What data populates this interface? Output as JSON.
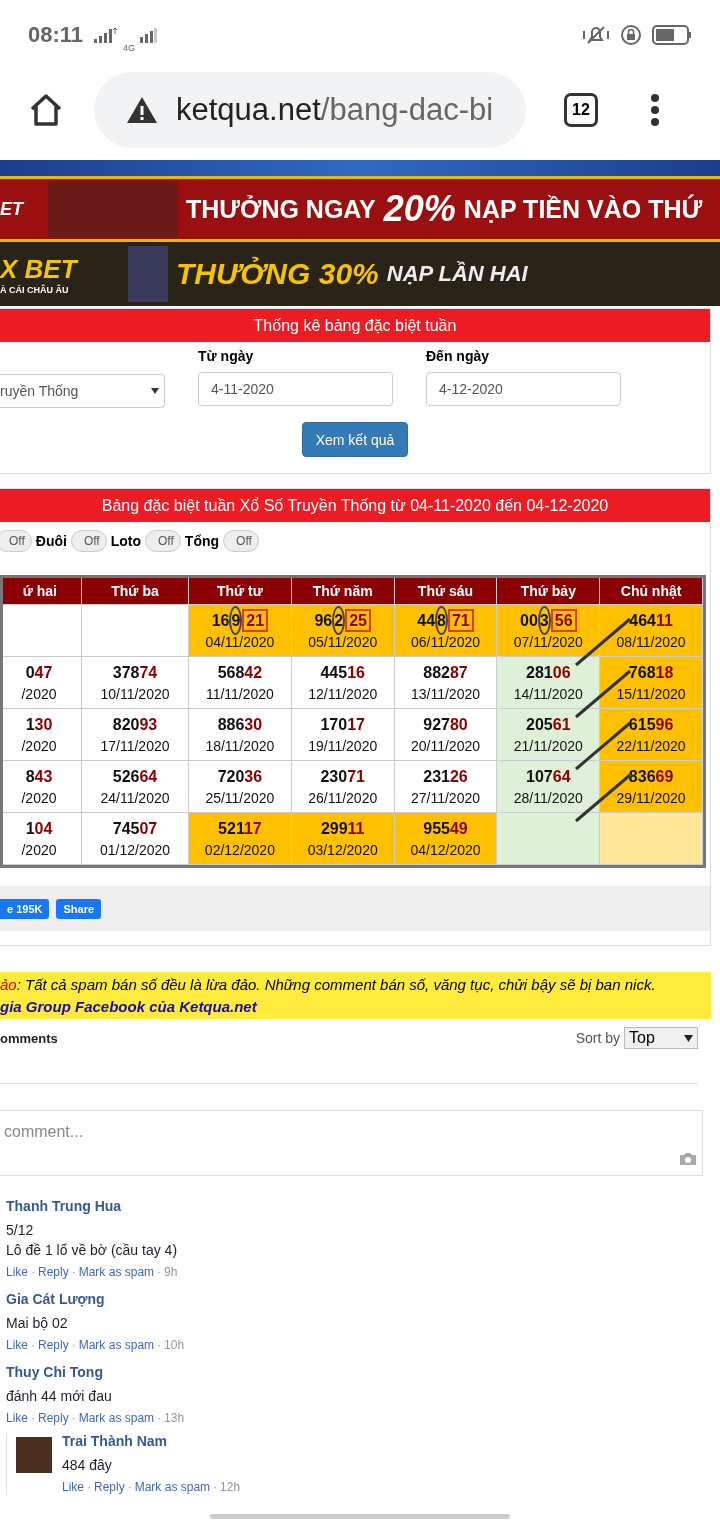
{
  "status_bar": {
    "time": "08:11",
    "network": "4G"
  },
  "browser": {
    "url_host": "ketqua.net",
    "url_path": "/bang-dac-bi",
    "tab_count": "12"
  },
  "banners": [
    {
      "headline": "THƯỞNG NGAY",
      "big": "20%",
      "tail": "NẠP TIỀN VÀO THỨ",
      "logo": "ET"
    },
    {
      "headline": "THƯỞNG 30%",
      "tail": "NẠP LẦN HAI",
      "logo": "X BET",
      "sub": "À CÁI CHÂU ÂU"
    }
  ],
  "filter_panel": {
    "title": "Thống kê bảng đặc biệt tuần",
    "type_select": {
      "value": "ruyền Thống"
    },
    "from": {
      "label": "Từ ngày",
      "value": "4-11-2020"
    },
    "to": {
      "label": "Đến ngày",
      "value": "4-12-2020"
    },
    "submit": "Xem kết quả"
  },
  "results_panel": {
    "title": "Bảng đặc biệt tuần Xổ Số Truyền Thống từ 04-11-2020 đến 04-12-2020",
    "toggles": [
      {
        "on": false,
        "state_text": "Off"
      },
      {
        "label": "Đuôi",
        "on": false,
        "state_text": "Off"
      },
      {
        "label": "Loto",
        "on": false,
        "state_text": "Off"
      },
      {
        "label": "Tổng",
        "on": false,
        "state_text": "Off"
      }
    ],
    "table": {
      "columns": [
        "ứ hai",
        "Thứ ba",
        "Thứ tư",
        "Thứ năm",
        "Thứ sáu",
        "Thứ bảy",
        "Chủ nhật"
      ],
      "rows": [
        [
          {
            "color": "#ffffff"
          },
          {
            "color": "#ffffff"
          },
          {
            "head": "16",
            "circled": "9",
            "tail": "21",
            "boxed": true,
            "date": "04/11/2020",
            "color": "#ffc000"
          },
          {
            "head": "96",
            "circled": "2",
            "tail": "25",
            "boxed": true,
            "date": "05/11/2020",
            "color": "#ffc000"
          },
          {
            "head": "44",
            "circled": "8",
            "tail": "71",
            "boxed": true,
            "date": "06/11/2020",
            "color": "#ffc000"
          },
          {
            "head": "00",
            "circled": "3",
            "tail": "56",
            "boxed": true,
            "date": "07/11/2020",
            "color": "#ffc000"
          },
          {
            "head": "464",
            "tail": "11",
            "date": "08/11/2020",
            "color": "#ffc000"
          }
        ],
        [
          {
            "head": "0",
            "tail": "47",
            "date": "/2020",
            "color": "#ffffff"
          },
          {
            "head": "378",
            "tail": "74",
            "date": "10/11/2020",
            "color": "#ffffff"
          },
          {
            "head": "568",
            "tail": "42",
            "date": "11/11/2020",
            "color": "#ffffff"
          },
          {
            "head": "445",
            "tail": "16",
            "date": "12/11/2020",
            "color": "#ffffff"
          },
          {
            "head": "882",
            "tail": "87",
            "date": "13/11/2020",
            "color": "#ffffff"
          },
          {
            "head": "281",
            "tail": "06",
            "date": "14/11/2020",
            "color": "#dff0d8"
          },
          {
            "head": "768",
            "tail": "18",
            "date": "15/11/2020",
            "color": "#ffc000"
          }
        ],
        [
          {
            "head": "1",
            "tail": "30",
            "date": "/2020",
            "color": "#ffffff"
          },
          {
            "head": "820",
            "tail": "93",
            "date": "17/11/2020",
            "color": "#ffffff"
          },
          {
            "head": "886",
            "tail": "30",
            "date": "18/11/2020",
            "color": "#ffffff"
          },
          {
            "head": "170",
            "tail": "17",
            "date": "19/11/2020",
            "color": "#ffffff"
          },
          {
            "head": "927",
            "tail": "80",
            "date": "20/11/2020",
            "color": "#ffffff"
          },
          {
            "head": "205",
            "tail": "61",
            "date": "21/11/2020",
            "color": "#dff0d8"
          },
          {
            "head": "615",
            "tail": "96",
            "date": "22/11/2020",
            "color": "#ffc000"
          }
        ],
        [
          {
            "head": "8",
            "tail": "43",
            "date": "/2020",
            "color": "#ffffff"
          },
          {
            "head": "526",
            "tail": "64",
            "date": "24/11/2020",
            "color": "#ffffff"
          },
          {
            "head": "720",
            "tail": "36",
            "date": "25/11/2020",
            "color": "#ffffff"
          },
          {
            "head": "230",
            "tail": "71",
            "date": "26/11/2020",
            "color": "#ffffff"
          },
          {
            "head": "231",
            "tail": "26",
            "date": "27/11/2020",
            "color": "#ffffff"
          },
          {
            "head": "107",
            "tail": "64",
            "date": "28/11/2020",
            "color": "#dff0d8"
          },
          {
            "head": "836",
            "tail": "69",
            "date": "29/11/2020",
            "color": "#ffc000"
          }
        ],
        [
          {
            "head": "1",
            "tail": "04",
            "date": "/2020",
            "color": "#ffffff"
          },
          {
            "head": "745",
            "tail": "07",
            "date": "01/12/2020",
            "color": "#ffffff"
          },
          {
            "head": "521",
            "tail": "17",
            "date": "02/12/2020",
            "color": "#ffc000"
          },
          {
            "head": "299",
            "tail": "11",
            "date": "03/12/2020",
            "color": "#ffc000"
          },
          {
            "head": "955",
            "tail": "49",
            "date": "04/12/2020",
            "color": "#ffc000"
          },
          {
            "color": "#dff0d8"
          },
          {
            "color": "#ffe699"
          }
        ]
      ]
    }
  },
  "social": {
    "like": "e 195K",
    "share": "Share"
  },
  "notice": {
    "lead": "ảo",
    "text": ": Tất cả spam bán số đều là lừa đảo. Những comment bán số, văng tục, chửi bậy sẽ bị ban nick.",
    "link": "gia Group Facebook của Ketqua.net"
  },
  "comments": {
    "count_label": "omments",
    "sort_label": "Sort by",
    "sort_value": "Top",
    "placeholder": "comment...",
    "items": [
      {
        "author": "Thanh Trung Hua",
        "lines": [
          "5/12",
          "Lô đề 1 lổ về bờ (cầu tay 4)"
        ],
        "actions": [
          "Like",
          "·",
          "Reply",
          "·",
          "Mark as spam",
          "·"
        ],
        "time": "9h"
      },
      {
        "author": "Gia Cát Lượng",
        "lines": [
          "Mai bộ 02"
        ],
        "actions": [
          "Like",
          "·",
          "Reply",
          "·",
          "Mark as spam",
          "·"
        ],
        "time": "10h"
      },
      {
        "author": "Thuy Chi Tong",
        "lines": [
          "đánh 44 mới đau"
        ],
        "actions": [
          "Like",
          "·",
          "Reply",
          "·",
          "Mark as spam",
          "·"
        ],
        "time": "13h",
        "children": [
          {
            "author": "Trai Thành Nam",
            "lines": [
              "484 đây"
            ],
            "actions": [
              "Like",
              "·",
              "Reply",
              "·",
              "Mark as spam",
              "·"
            ],
            "time": "12h"
          }
        ]
      }
    ]
  }
}
